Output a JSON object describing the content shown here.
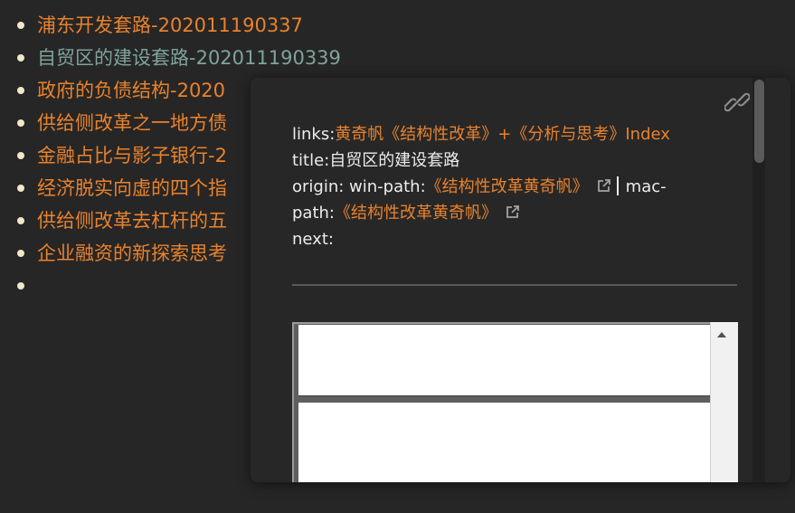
{
  "note_list": {
    "items": [
      {
        "text": "浦东开发套路-202011190337",
        "style": "link"
      },
      {
        "text": "自贸区的建设套路-202011190339",
        "style": "active"
      },
      {
        "text": "政府的负债结构-2020",
        "style": "link"
      },
      {
        "text": "供给侧改革之一地方债",
        "style": "link"
      },
      {
        "text": "金融占比与影子银行-2",
        "style": "link"
      },
      {
        "text": "经济脱实向虚的四个指",
        "style": "link"
      },
      {
        "text": "供给侧改革去杠杆的五",
        "style": "link"
      },
      {
        "text": "企业融资的新探索思考",
        "style": "link"
      },
      {
        "text": "",
        "style": "empty"
      }
    ]
  },
  "preview": {
    "links_label": "links:",
    "links_value": "黄奇帆《结构性改革》+《分析与思考》Index",
    "title_label": "title:",
    "title_value": "自贸区的建设套路",
    "origin_label": "origin: win-path:",
    "origin_win_link": "《结构性改革黄奇帆》",
    "origin_mac_label": "mac-",
    "origin_path_label": "path:",
    "origin_mac_link": "《结构性改革黄奇帆》",
    "next_label": "next:"
  },
  "icons": {
    "link": "chain-link-icon",
    "external": "external-link-icon",
    "scroll_up": "scroll-up-arrow-icon"
  },
  "colors": {
    "background": "#262626",
    "link": "#e9822d",
    "active_link": "#7fa39b",
    "bullet": "#f1e7c9",
    "popover_bg": "#272727",
    "text": "#ececec"
  }
}
